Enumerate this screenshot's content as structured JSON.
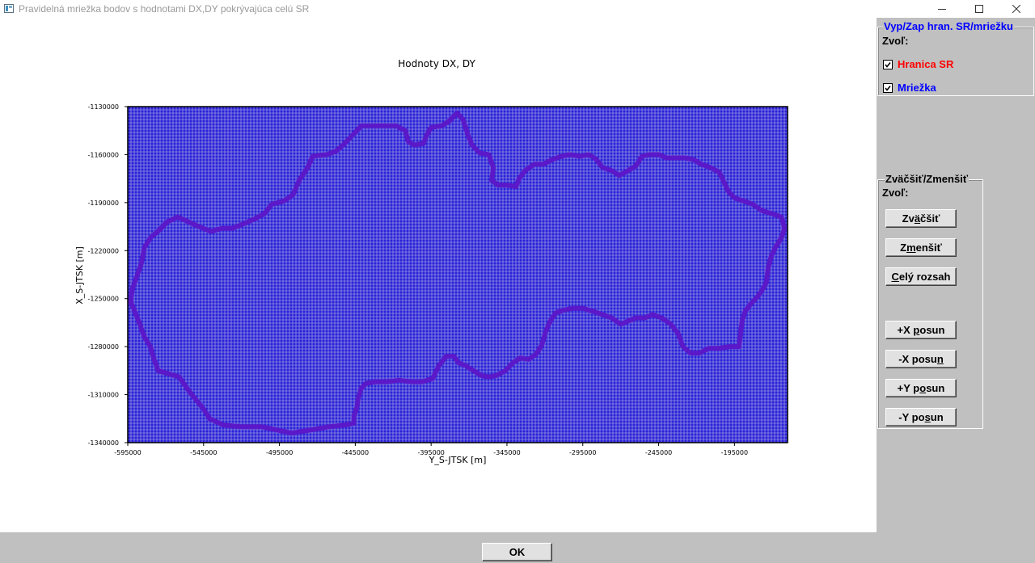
{
  "window": {
    "title": "Pravidelná mriežka bodov s hodnotami DX,DY pokrývajúca celú SR",
    "icon": "app-icon",
    "controls": [
      "minimize-icon",
      "maximize-icon",
      "close-icon"
    ]
  },
  "chart_data": {
    "type": "scatter",
    "title": "Hodnoty DX, DY",
    "xlabel": "Y_S-JTSK [m]",
    "ylabel": "X_S-JTSK [m]",
    "xlim": [
      -595000,
      -160000
    ],
    "ylim": [
      -1340000,
      -1130000
    ],
    "xticks": [
      -595000,
      -545000,
      -495000,
      -445000,
      -395000,
      -345000,
      -295000,
      -245000,
      -195000
    ],
    "yticks": [
      -1130000,
      -1160000,
      -1190000,
      -1220000,
      -1250000,
      -1280000,
      -1310000,
      -1340000
    ],
    "grid": true,
    "grid_color": "#2a22d8",
    "grid_line_color": "#e8e8e8",
    "boundary_color": "#5b18c8",
    "boundary": [
      [
        -446000,
        -1328000
      ],
      [
        -452000,
        -1329000
      ],
      [
        -462000,
        -1330000
      ],
      [
        -474000,
        -1332000
      ],
      [
        -487000,
        -1334000
      ],
      [
        -497000,
        -1332000
      ],
      [
        -507000,
        -1330000
      ],
      [
        -520000,
        -1330000
      ],
      [
        -532000,
        -1329000
      ],
      [
        -541000,
        -1325000
      ],
      [
        -545000,
        -1319000
      ],
      [
        -551000,
        -1312000
      ],
      [
        -556000,
        -1306000
      ],
      [
        -561000,
        -1299000
      ],
      [
        -568000,
        -1297000
      ],
      [
        -575000,
        -1295000
      ],
      [
        -578000,
        -1287000
      ],
      [
        -580000,
        -1280000
      ],
      [
        -584000,
        -1274000
      ],
      [
        -587000,
        -1266000
      ],
      [
        -590000,
        -1259000
      ],
      [
        -593000,
        -1252000
      ],
      [
        -592000,
        -1244000
      ],
      [
        -589000,
        -1236000
      ],
      [
        -586000,
        -1228000
      ],
      [
        -584000,
        -1218000
      ],
      [
        -580000,
        -1212000
      ],
      [
        -574000,
        -1207000
      ],
      [
        -569000,
        -1202000
      ],
      [
        -562000,
        -1199000
      ],
      [
        -555000,
        -1202000
      ],
      [
        -548000,
        -1205000
      ],
      [
        -540000,
        -1208000
      ],
      [
        -533000,
        -1206000
      ],
      [
        -526000,
        -1206000
      ],
      [
        -518000,
        -1203000
      ],
      [
        -511000,
        -1200000
      ],
      [
        -505000,
        -1197000
      ],
      [
        -500000,
        -1191000
      ],
      [
        -492000,
        -1189000
      ],
      [
        -486000,
        -1185000
      ],
      [
        -482000,
        -1176000
      ],
      [
        -477000,
        -1169000
      ],
      [
        -473000,
        -1161000
      ],
      [
        -464000,
        -1160000
      ],
      [
        -458000,
        -1158000
      ],
      [
        -453000,
        -1154000
      ],
      [
        -448000,
        -1149000
      ],
      [
        -441000,
        -1142000
      ],
      [
        -433000,
        -1142000
      ],
      [
        -426000,
        -1142000
      ],
      [
        -418000,
        -1142000
      ],
      [
        -412000,
        -1145000
      ],
      [
        -410000,
        -1152000
      ],
      [
        -406000,
        -1154000
      ],
      [
        -400000,
        -1153000
      ],
      [
        -398000,
        -1148000
      ],
      [
        -395000,
        -1143000
      ],
      [
        -388000,
        -1142000
      ],
      [
        -383000,
        -1139000
      ],
      [
        -378000,
        -1134000
      ],
      [
        -374000,
        -1138000
      ],
      [
        -371000,
        -1147000
      ],
      [
        -368000,
        -1154000
      ],
      [
        -363000,
        -1159000
      ],
      [
        -357000,
        -1160000
      ],
      [
        -354000,
        -1168000
      ],
      [
        -355000,
        -1176000
      ],
      [
        -351000,
        -1179000
      ],
      [
        -345000,
        -1179000
      ],
      [
        -339000,
        -1180000
      ],
      [
        -337000,
        -1175000
      ],
      [
        -333000,
        -1170000
      ],
      [
        -327000,
        -1166000
      ],
      [
        -321000,
        -1166000
      ],
      [
        -315000,
        -1163000
      ],
      [
        -309000,
        -1161000
      ],
      [
        -304000,
        -1160000
      ],
      [
        -297000,
        -1161000
      ],
      [
        -291000,
        -1160000
      ],
      [
        -286000,
        -1163000
      ],
      [
        -282000,
        -1168000
      ],
      [
        -276000,
        -1170000
      ],
      [
        -271000,
        -1173000
      ],
      [
        -265000,
        -1170000
      ],
      [
        -260000,
        -1167000
      ],
      [
        -256000,
        -1161000
      ],
      [
        -251000,
        -1160000
      ],
      [
        -245000,
        -1160000
      ],
      [
        -240000,
        -1162000
      ],
      [
        -234000,
        -1162000
      ],
      [
        -228000,
        -1162000
      ],
      [
        -222000,
        -1163000
      ],
      [
        -217000,
        -1166000
      ],
      [
        -211000,
        -1168000
      ],
      [
        -205000,
        -1171000
      ],
      [
        -202000,
        -1177000
      ],
      [
        -199000,
        -1183000
      ],
      [
        -195000,
        -1187000
      ],
      [
        -189000,
        -1189000
      ],
      [
        -183000,
        -1191000
      ],
      [
        -177000,
        -1195000
      ],
      [
        -170000,
        -1197000
      ],
      [
        -164000,
        -1199000
      ],
      [
        -162000,
        -1206000
      ],
      [
        -164000,
        -1212000
      ],
      [
        -168000,
        -1218000
      ],
      [
        -171000,
        -1224000
      ],
      [
        -173000,
        -1232000
      ],
      [
        -174000,
        -1240000
      ],
      [
        -177000,
        -1245000
      ],
      [
        -180000,
        -1249000
      ],
      [
        -184000,
        -1253000
      ],
      [
        -188000,
        -1258000
      ],
      [
        -190000,
        -1264000
      ],
      [
        -191000,
        -1272000
      ],
      [
        -192000,
        -1280000
      ],
      [
        -198000,
        -1280000
      ],
      [
        -205000,
        -1281000
      ],
      [
        -212000,
        -1281000
      ],
      [
        -218000,
        -1284000
      ],
      [
        -224000,
        -1284000
      ],
      [
        -229000,
        -1280000
      ],
      [
        -232000,
        -1272000
      ],
      [
        -237000,
        -1266000
      ],
      [
        -243000,
        -1262000
      ],
      [
        -249000,
        -1260000
      ],
      [
        -254000,
        -1262000
      ],
      [
        -260000,
        -1262000
      ],
      [
        -265000,
        -1264000
      ],
      [
        -270000,
        -1266000
      ],
      [
        -276000,
        -1262000
      ],
      [
        -282000,
        -1260000
      ],
      [
        -288000,
        -1258000
      ],
      [
        -295000,
        -1256000
      ],
      [
        -301000,
        -1256000
      ],
      [
        -307000,
        -1257000
      ],
      [
        -313000,
        -1259000
      ],
      [
        -317000,
        -1265000
      ],
      [
        -320000,
        -1272000
      ],
      [
        -322000,
        -1279000
      ],
      [
        -326000,
        -1285000
      ],
      [
        -331000,
        -1288000
      ],
      [
        -336000,
        -1287000
      ],
      [
        -341000,
        -1290000
      ],
      [
        -346000,
        -1295000
      ],
      [
        -352000,
        -1298000
      ],
      [
        -357000,
        -1299000
      ],
      [
        -362000,
        -1298000
      ],
      [
        -367000,
        -1295000
      ],
      [
        -372000,
        -1292000
      ],
      [
        -377000,
        -1290000
      ],
      [
        -380000,
        -1286000
      ],
      [
        -385000,
        -1286000
      ],
      [
        -390000,
        -1292000
      ],
      [
        -394000,
        -1300000
      ],
      [
        -401000,
        -1302000
      ],
      [
        -408000,
        -1302000
      ],
      [
        -416000,
        -1301000
      ],
      [
        -424000,
        -1302000
      ],
      [
        -432000,
        -1302000
      ],
      [
        -438000,
        -1303000
      ],
      [
        -441000,
        -1306000
      ],
      [
        -443000,
        -1312000
      ],
      [
        -444000,
        -1318000
      ],
      [
        -446000,
        -1324000
      ],
      [
        -446000,
        -1328000
      ]
    ]
  },
  "panel": {
    "boundary_group": {
      "title": "Vyp/Zap hran. SR/mriežku",
      "prompt": "Zvoľ:",
      "options": [
        {
          "label": "Hranica SR",
          "checked": true,
          "color": "#ff0000"
        },
        {
          "label": "Mriežka",
          "checked": true,
          "color": "#0000ff"
        }
      ]
    },
    "zoom_group": {
      "title": "Zväčšiť/Zmenšiť",
      "prompt": "Zvoľ:",
      "zoom_in": {
        "pre": "Zv",
        "key": "ä",
        "post": "čšiť"
      },
      "zoom_out": {
        "pre": "Z",
        "key": "m",
        "post": "enšiť"
      },
      "full_range": {
        "pre": "",
        "key": "C",
        "post": "elý rozsah"
      },
      "plus_x": {
        "pre": "+X ",
        "key": "p",
        "post": "osun"
      },
      "minus_x": {
        "pre": "-X posu",
        "key": "n",
        "post": ""
      },
      "plus_y": {
        "pre": "+Y p",
        "key": "o",
        "post": "sun"
      },
      "minus_y": {
        "pre": "-Y po",
        "key": "s",
        "post": "un"
      }
    }
  },
  "footer": {
    "ok_label": "OK"
  }
}
